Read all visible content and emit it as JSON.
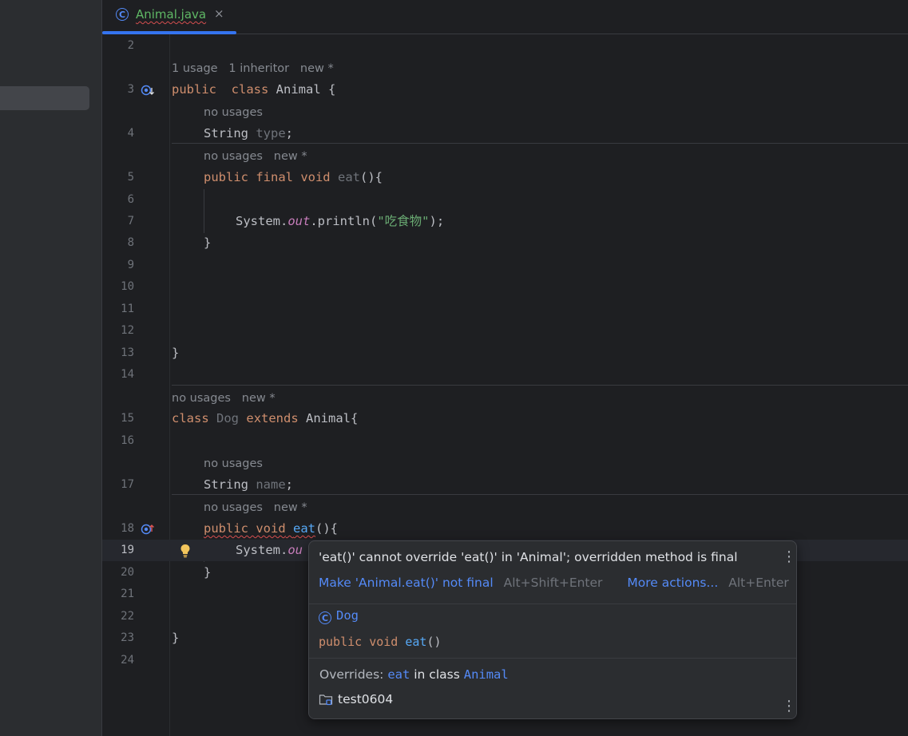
{
  "tab": {
    "title": "Animal.java",
    "close": "×",
    "icon": "class-icon",
    "icon_glyph": "C"
  },
  "lines": [
    {
      "n": "2"
    },
    {
      "n": "3"
    },
    {
      "n": "4"
    },
    {
      "n": "5"
    },
    {
      "n": "6"
    },
    {
      "n": "7"
    },
    {
      "n": "8"
    },
    {
      "n": "9"
    },
    {
      "n": "10"
    },
    {
      "n": "11"
    },
    {
      "n": "12"
    },
    {
      "n": "13"
    },
    {
      "n": "14"
    },
    {
      "n": "15"
    },
    {
      "n": "16"
    },
    {
      "n": "17"
    },
    {
      "n": "18"
    },
    {
      "n": "19"
    },
    {
      "n": "20"
    },
    {
      "n": "21"
    },
    {
      "n": "22"
    },
    {
      "n": "23"
    },
    {
      "n": "24"
    }
  ],
  "hints": {
    "animal_class": "1 usage   1 inheritor   new *",
    "type_field": "no usages",
    "eat_method": "no usages   new *",
    "dog_class": "no usages   new *",
    "name_field": "no usages",
    "dog_eat": "no usages   new *"
  },
  "code": {
    "l3_kw1": "public",
    "l3_kw2": "class",
    "l3_rest": " Animal {",
    "l4_type": "String",
    "l4_name": "type",
    "l4_end": ";",
    "l5_kw": "public final void",
    "l5_name": "eat",
    "l5_rest": "(){",
    "l7_sys": "System.",
    "l7_out": "out",
    "l7_call": ".println(",
    "l7_str": "\"吃食物\"",
    "l7_end": ");",
    "l8": "}",
    "l13": "}",
    "l15_kw1": "class",
    "l15_name": "Dog",
    "l15_kw2": "extends",
    "l15_rest": " Animal{",
    "l17_type": "String",
    "l17_name": "name",
    "l17_end": ";",
    "l18_kw": "public void",
    "l18_name": "eat",
    "l18_rest": "(){",
    "l19_sys": "System.",
    "l19_out": "ou",
    "l20": "}",
    "l23": "}"
  },
  "popup": {
    "error": "'eat()' cannot override 'eat()' in 'Animal'; overridden method is final",
    "fix_action": "Make 'Animal.eat()' not final",
    "fix_shortcut": "Alt+Shift+Enter",
    "more_actions": "More actions...",
    "more_shortcut": "Alt+Enter",
    "class_name": "Dog",
    "class_icon_glyph": "C",
    "sig_kw": "public void",
    "sig_name": "eat",
    "sig_rest": "()",
    "overrides_label": "Overrides:",
    "overrides_method": "eat",
    "overrides_in": "in class",
    "overrides_class": "Animal",
    "module": "test0604",
    "kebab": "⋮"
  },
  "colors": {
    "accent": "#3574f0",
    "keyword": "#cf8e6d",
    "string": "#6aab73",
    "method": "#56a8f5",
    "error_underline": "#d64f4f"
  }
}
